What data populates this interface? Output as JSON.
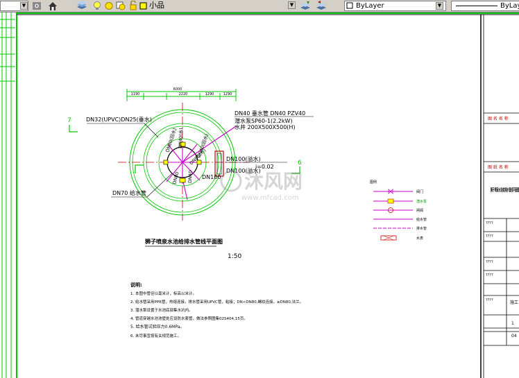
{
  "toolbar": {
    "layer_name": "小品",
    "color_value": "ByLayer",
    "linetype_value": "ByLayer",
    "layer_swatch_color": "#ffff00"
  },
  "drawing": {
    "overall_dim": "6000",
    "dims": [
      "1190",
      "2220",
      "1290",
      "1290"
    ],
    "section_mark_left": "7",
    "section_mark_right": "6",
    "pipe_dn32": "DN32(UPVC)DN25(垂水)",
    "pipe_dn40": "DN40 垂水管 DN40 PZV40",
    "pump_model": "潜水泵SP60-1(2.2kW)",
    "pit_size": "水井 200X500X500(H)",
    "dn100_a": "DN100(溢水)",
    "dn100_b": "DN100(溢水)",
    "slope": "i=0.02",
    "dn100_c": "DN100",
    "dn70": "DN70 给水管",
    "radial_1": "DN80(回水)",
    "radial_2": "DN40(水)",
    "radial_3": "DN80(水)",
    "radial_4": "DN40(回水)",
    "radial_5": "DN80",
    "radial_6": "DN40",
    "title": "狮子喷泉水池给排水管线平面图",
    "scale": "1:50",
    "notes_title": "说明:",
    "notes": [
      "1. 本图中管径以毫米计，标高以米计。",
      "2. 给水管采用PPR管，热熔连接，排水管采用UPVC管，粘接；DN<DN80,螺纹连接，≥DN80,法兰。",
      "3. 潜水泵设置于水池底部集水坑内。",
      "4. 管道穿越水池池壁处应设防水套管，做法参照图集02S404,15页。",
      "5. 给水管试验压力0.6MPa。",
      "6. 未尽事宜按有关规范施工。"
    ],
    "legend_title": "图例",
    "legend": [
      "阀门",
      "潜水泵",
      "闸阀",
      "给水管",
      "排水管",
      "水表"
    ],
    "watermark_cn": "沐风网",
    "watermark_url": "www.mfcad.com"
  },
  "titleblock": {
    "header": "图 名 名 称",
    "header2": "图 纸 名 称",
    "drawing_title": "狮子喷泉水池给排水管线平面图",
    "cells": [
      "????",
      "????",
      "????",
      "????",
      "????",
      "施工",
      "1",
      "04"
    ]
  }
}
